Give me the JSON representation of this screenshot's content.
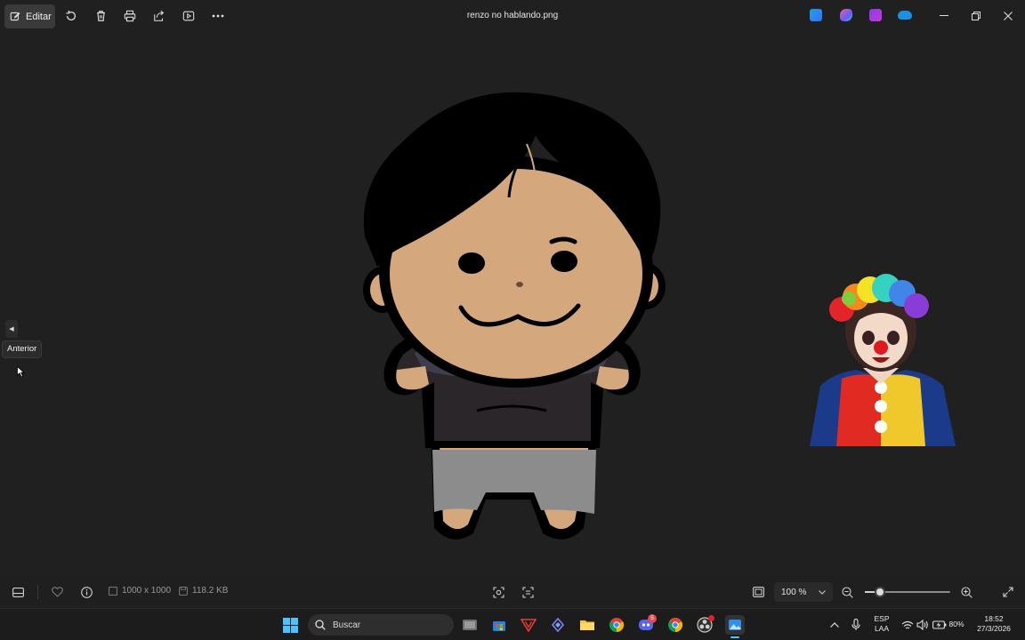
{
  "toolbar": {
    "edit_label": "Editar",
    "file_title": "renzo no hablando.png",
    "icons": [
      "rotate-icon",
      "delete-icon",
      "print-icon",
      "share-icon",
      "slideshow-icon",
      "more-icon"
    ],
    "app_icons": [
      "image-editor-icon",
      "copilot-icon",
      "clipchamp-icon",
      "onedrive-icon"
    ]
  },
  "viewer": {
    "prev_tooltip": "Anterior"
  },
  "status": {
    "dimensions": "1000 x 1000",
    "file_size": "118.2 KB",
    "zoom": "100 %",
    "zoom_fraction": 0.18
  },
  "taskbar": {
    "search_placeholder": "Buscar",
    "language_top": "ESP",
    "language_bottom": "LAA",
    "battery": "80%",
    "time": "18:52",
    "date": "27/3/2026",
    "discord_badge": "5"
  },
  "colors": {
    "background": "#202020",
    "skin": "#d4a77d",
    "hair": "#000000",
    "shirt": "#3f3e4e",
    "pants": "#8c8c8c",
    "accent": "#4fc3f7"
  }
}
